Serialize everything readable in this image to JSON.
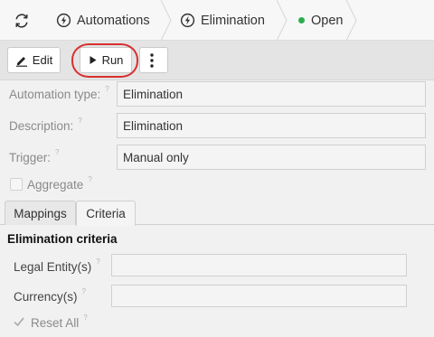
{
  "breadcrumb": {
    "refresh_icon": "refresh-icon",
    "items": [
      {
        "label": "Automations",
        "icon": "lightning-icon"
      },
      {
        "label": "Elimination",
        "icon": "lightning-icon"
      },
      {
        "label": "Open",
        "status_color": "#2cae4f"
      }
    ]
  },
  "toolbar": {
    "edit_label": "Edit",
    "run_label": "Run",
    "more_icon": "kebab-menu-icon",
    "highlight_color": "#d8302f"
  },
  "form": {
    "automation_type_label": "Automation type:",
    "automation_type_value": "Elimination",
    "description_label": "Description:",
    "description_value": "Elimination",
    "trigger_label": "Trigger:",
    "trigger_value": "Manual only",
    "aggregate_label": "Aggregate",
    "help_glyph": "?"
  },
  "tabs": [
    {
      "label": "Mappings",
      "active": false
    },
    {
      "label": "Criteria",
      "active": true
    }
  ],
  "criteria": {
    "title": "Elimination criteria",
    "legal_entity_label": "Legal Entity(s)",
    "legal_entity_value": "",
    "currency_label": "Currency(s)",
    "currency_value": "",
    "reset_all_label": "Reset All",
    "reset_all_checked": true
  }
}
